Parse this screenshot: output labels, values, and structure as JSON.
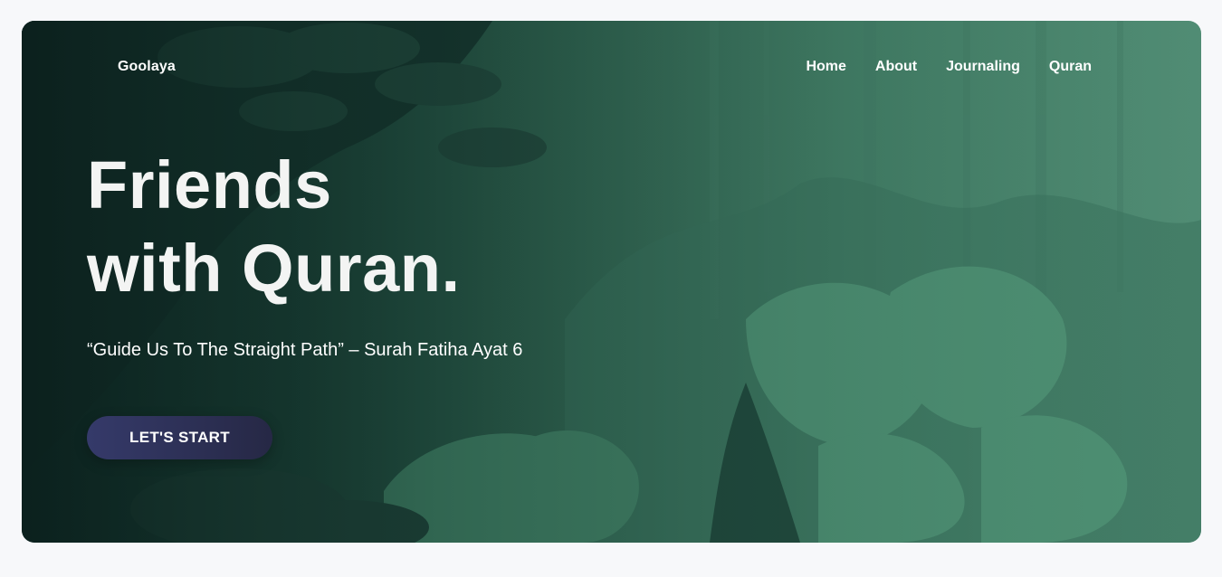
{
  "header": {
    "brand": "Goolaya",
    "nav": [
      {
        "label": "Home"
      },
      {
        "label": "About"
      },
      {
        "label": "Journaling"
      },
      {
        "label": "Quran"
      }
    ]
  },
  "hero": {
    "headline_line1": "Friends",
    "headline_line2": "with Quran.",
    "subtitle": "“Guide Us To The Straight Path” – Surah Fatiha Ayat 6",
    "cta_label": "LET'S START"
  },
  "colors": {
    "page_background": "#f7f8fa",
    "hero_dark": "#0e2a26",
    "hero_light": "#4f8a72",
    "cta": "#353a6a",
    "text": "#ffffff"
  }
}
